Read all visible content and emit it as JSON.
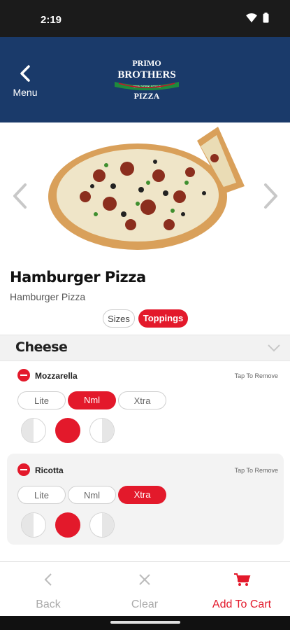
{
  "status": {
    "time": "2:19"
  },
  "header": {
    "menu_label": "Menu",
    "logo": {
      "line1": "PRIMO",
      "line2": "BROTHERS",
      "line3": "NEW YORK STYLE",
      "line4": "PIZZA"
    }
  },
  "item": {
    "title": "Hamburger Pizza",
    "subtitle": "Hamburger Pizza"
  },
  "segments": {
    "sizes": "Sizes",
    "toppings": "Toppings",
    "selected": "Toppings"
  },
  "section": {
    "title": "Cheese"
  },
  "toppings": [
    {
      "name": "Mozzarella",
      "tap": "Tap To Remove",
      "amounts": [
        "Lite",
        "Nml",
        "Xtra"
      ],
      "selected_amount": "Nml",
      "coverage": "whole"
    },
    {
      "name": "Ricotta",
      "tap": "Tap To Remove",
      "amounts": [
        "Lite",
        "Nml",
        "Xtra"
      ],
      "selected_amount": "Xtra",
      "coverage": "whole"
    }
  ],
  "bottom": {
    "back": "Back",
    "clear": "Clear",
    "add": "Add To Cart"
  },
  "colors": {
    "accent": "#e3192b",
    "header": "#1a3a6a"
  },
  "icons": [
    "wifi-icon",
    "battery-icon",
    "back-chevron-icon",
    "prev-arrow-icon",
    "next-arrow-icon",
    "chevron-down-icon",
    "minus-icon",
    "close-icon",
    "cart-icon"
  ]
}
